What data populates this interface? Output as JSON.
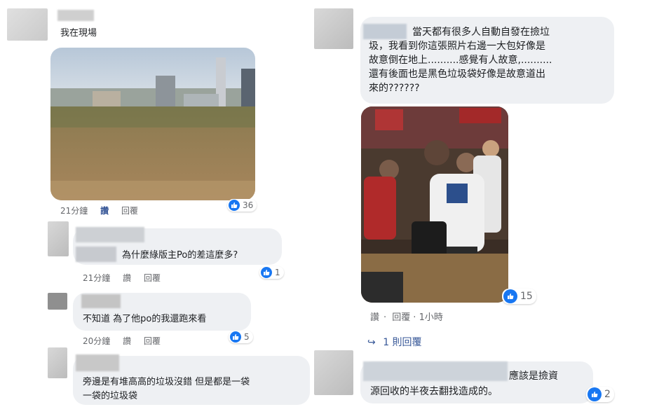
{
  "left": {
    "c1": {
      "text": "我在現場",
      "time": "21分鐘",
      "like": "讚",
      "reply": "回覆",
      "reactions": "36"
    },
    "c2": {
      "text": "為什麼綠版主Po的差這麼多?",
      "time": "21分鐘",
      "like": "讚",
      "reply": "回覆",
      "reactions": "1"
    },
    "c3": {
      "text": "不知道 為了他po的我還跑來看",
      "time": "20分鐘",
      "like": "讚",
      "reply": "回覆",
      "reactions": "5"
    },
    "c4": {
      "text": "旁邊是有堆高高的垃圾沒錯 但是都是一袋\n一袋的垃圾袋"
    }
  },
  "right": {
    "c1": {
      "text": "當天都有很多人自動自發在撿垃\n圾，我看到你這張照片右邊一大包好像是\n故意倒在地上..........感覺有人故意,..........\n還有後面也是黑色垃圾袋好像是故意道出\n來的??????",
      "time": "1小時",
      "like": "讚",
      "reply": "回覆",
      "reactions": "15",
      "replies": "1 則回覆"
    },
    "c2": {
      "text": "應該是撿資\n源回收的半夜去翻找造成的。",
      "reactions": "2"
    }
  },
  "colors": {
    "like_blue": "#1877f2",
    "bubble": "#eef0f3",
    "link": "#385898"
  },
  "icons": {
    "like": "thumbs-up-icon",
    "reply_arrow": "reply-arrow-icon"
  }
}
